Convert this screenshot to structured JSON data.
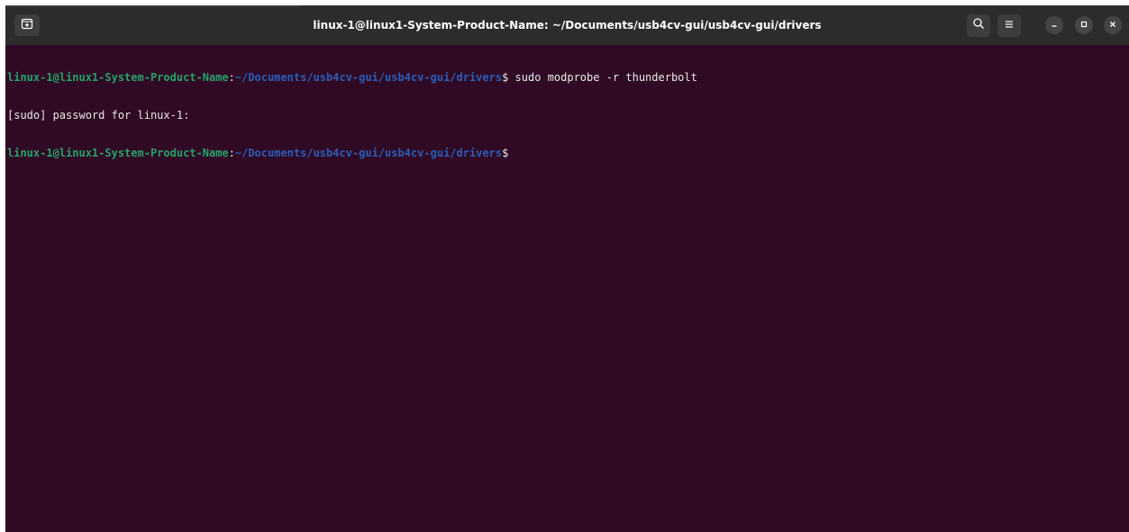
{
  "window": {
    "title": "linux-1@linux1-System-Product-Name: ~/Documents/usb4cv-gui/usb4cv-gui/drivers"
  },
  "toolbar": {
    "new_tab_icon": "new-tab-icon",
    "search_icon": "search-icon",
    "menu_icon": "hamburger-menu-icon",
    "minimize_icon": "minimize-icon",
    "maximize_icon": "maximize-icon",
    "close_icon": "close-icon"
  },
  "terminal": {
    "lines": [
      {
        "user": "linux-1@linux1-System-Product-Name",
        "sep": ":",
        "path": "~/Documents/usb4cv-gui/usb4cv-gui/drivers",
        "prompt": "$",
        "command": " sudo modprobe -r thunderbolt"
      },
      {
        "text": "[sudo] password for linux-1:"
      },
      {
        "user": "linux-1@linux1-System-Product-Name",
        "sep": ":",
        "path": "~/Documents/usb4cv-gui/usb4cv-gui/drivers",
        "prompt": "$",
        "command": ""
      }
    ]
  },
  "colors": {
    "background": "#300a24",
    "titlebar": "#2c2c2c",
    "user": "#26a269",
    "path": "#2a5db8",
    "text": "#e8e8e8"
  }
}
